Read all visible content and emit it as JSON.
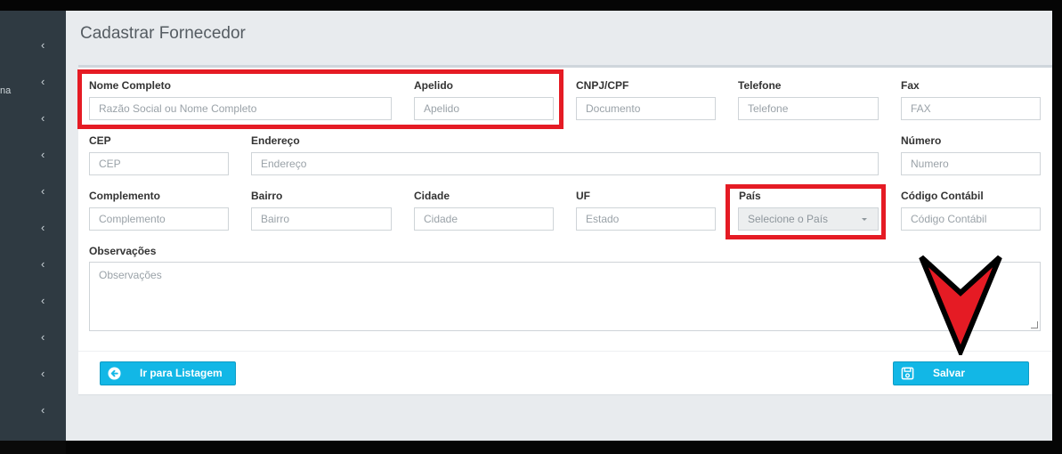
{
  "sidebar": {
    "stub_text": "na",
    "chevron_count": 11
  },
  "page": {
    "title": "Cadastrar Fornecedor"
  },
  "form": {
    "nome_completo": {
      "label": "Nome Completo",
      "placeholder": "Razão Social ou Nome Completo"
    },
    "apelido": {
      "label": "Apelido",
      "placeholder": "Apelido"
    },
    "cnpj_cpf": {
      "label": "CNPJ/CPF",
      "placeholder": "Documento"
    },
    "telefone": {
      "label": "Telefone",
      "placeholder": "Telefone"
    },
    "fax": {
      "label": "Fax",
      "placeholder": "FAX"
    },
    "cep": {
      "label": "CEP",
      "placeholder": "CEP"
    },
    "endereco": {
      "label": "Endereço",
      "placeholder": "Endereço"
    },
    "numero": {
      "label": "Número",
      "placeholder": "Numero"
    },
    "complemento": {
      "label": "Complemento",
      "placeholder": "Complemento"
    },
    "bairro": {
      "label": "Bairro",
      "placeholder": "Bairro"
    },
    "cidade": {
      "label": "Cidade",
      "placeholder": "Cidade"
    },
    "uf": {
      "label": "UF",
      "placeholder": "Estado"
    },
    "pais": {
      "label": "País",
      "selected": "Selecione o País"
    },
    "codigo_contabil": {
      "label": "Código Contábil",
      "placeholder": "Código Contábil"
    },
    "observacoes": {
      "label": "Observações",
      "placeholder": "Observações"
    }
  },
  "actions": {
    "back_label": "Ir para Listagem",
    "save_label": "Salvar"
  },
  "colors": {
    "accent": "#12b7e6",
    "highlight": "#e51b24",
    "sidebar": "#2f3a42"
  },
  "icons": {
    "back": "arrow-left-circle-icon",
    "save": "floppy-disk-icon",
    "sidebar": "chevron-left-icon"
  }
}
